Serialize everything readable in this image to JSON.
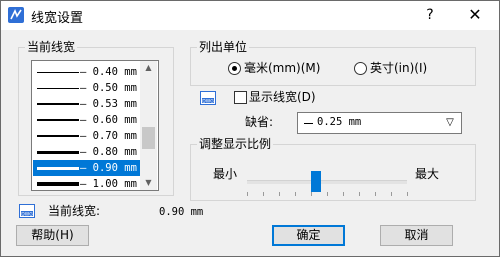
{
  "title_bar": {
    "title": "线宽设置",
    "help_symbol": "?",
    "close_symbol": "✕"
  },
  "current_lineweight_group": {
    "title": "当前线宽",
    "items": [
      {
        "label": "— 0.40 mm",
        "weight": 1
      },
      {
        "label": "— 0.50 mm",
        "weight": 1
      },
      {
        "label": "— 0.53 mm",
        "weight": 2
      },
      {
        "label": "— 0.60 mm",
        "weight": 2
      },
      {
        "label": "— 0.70 mm",
        "weight": 2
      },
      {
        "label": "— 0.80 mm",
        "weight": 3
      },
      {
        "label": "— 0.90 mm",
        "weight": 3
      },
      {
        "label": "— 1.00 mm",
        "weight": 4
      }
    ],
    "selected_index": 6
  },
  "units_group": {
    "title": "列出单位",
    "option_mm": "毫米(mm)(M)",
    "option_inch": "英寸(in)(I)",
    "selected": "mm"
  },
  "show_lineweight": {
    "label": "显示线宽(D)",
    "checked": false
  },
  "default_field": {
    "label": "缺省:",
    "value": "0.25 mm"
  },
  "display_scale_group": {
    "title": "调整显示比例",
    "min_label": "最小",
    "max_label": "最大",
    "slider_fraction": 0.43
  },
  "current_status": {
    "label": "当前线宽:",
    "value": "0.90 mm"
  },
  "buttons": {
    "help": "帮助(H)",
    "ok": "确定",
    "cancel": "取消"
  },
  "icons": {
    "app": "dwg-app-icon",
    "dwg": "dwg-icon"
  },
  "colors": {
    "selection": "#0078d7",
    "slider_thumb": "#0078d7"
  }
}
